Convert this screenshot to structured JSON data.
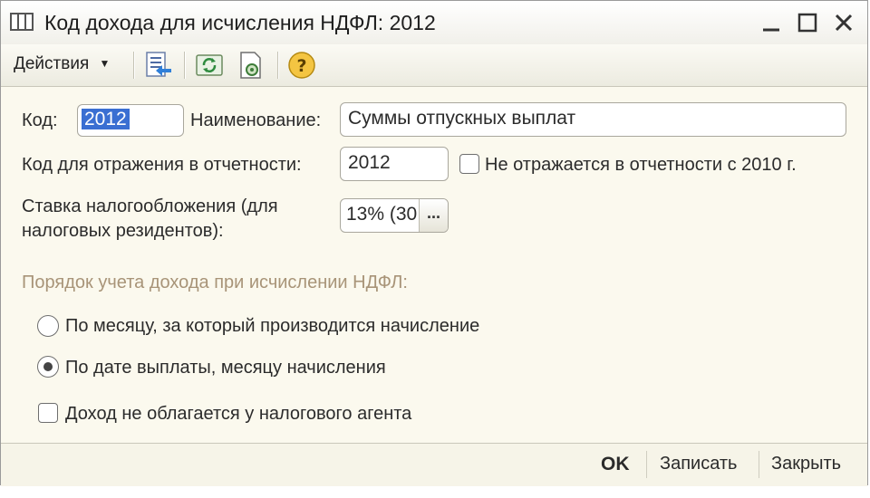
{
  "window": {
    "title": "Код дохода для исчисления НДФЛ: 2012"
  },
  "toolbar": {
    "actions_label": "Действия"
  },
  "form": {
    "code_label": "Код:",
    "code_value": "2012",
    "name_label": "Наименование:",
    "name_value": "Суммы отпускных выплат",
    "report_code_label": "Код для отражения в отчетности:",
    "report_code_value": "2012",
    "not_reported_label": "Не отражается в отчетности с 2010 г.",
    "rate_label_line1": "Ставка налогообложения (для",
    "rate_label_line2": "налоговых резидентов):",
    "rate_value": "13% (30",
    "rate_button": "...",
    "order_section": "Порядок учета дохода при исчислении НДФЛ:",
    "radio_month": "По месяцу, за который производится начисление",
    "radio_payment": "По дате выплаты, месяцу начисления",
    "not_taxed_label": "Доход не облагается у налогового агента"
  },
  "footer": {
    "ok": "OK",
    "save": "Записать",
    "close": "Закрыть"
  },
  "icons": [
    "table-icon",
    "minimize-icon",
    "maximize-icon",
    "close-icon",
    "dropdown-arrow-icon",
    "list-arrow-icon",
    "refresh-icon",
    "settings-doc-icon",
    "help-icon"
  ]
}
